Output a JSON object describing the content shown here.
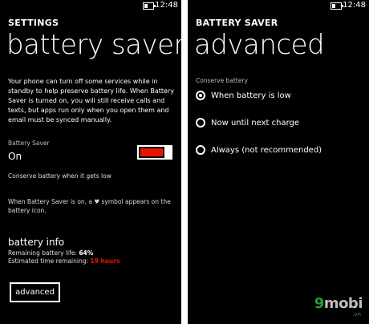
{
  "status": {
    "time": "12:48"
  },
  "left": {
    "section": "SETTINGS",
    "title": "battery saver",
    "description": "Your phone can turn off some services while in standby to help preserve battery life. When Battery Saver is turned on, you will still receive calls and texts, but apps run only when you open them and email must be synced manually.",
    "toggle": {
      "label": "Battery Saver",
      "state": "On",
      "on": true,
      "accent": "#e51400"
    },
    "conserve_note": "Conserve battery when it gets low",
    "symbol_note": "When Battery Saver is on, a ♥ symbol appears on the battery icon.",
    "info": {
      "heading": "battery info",
      "remaining_label": "Remaining battery life:",
      "remaining_value": "64%",
      "estimated_label": "Estimated time remaining:",
      "estimated_value": "19 hours"
    },
    "advanced_button": "advanced"
  },
  "right": {
    "section": "BATTERY SAVER",
    "title": "advanced",
    "group_label": "Conserve battery",
    "options": [
      {
        "label": "When battery is low",
        "selected": true
      },
      {
        "label": "Now until next charge",
        "selected": false
      },
      {
        "label": "Always (not recommended)",
        "selected": false
      }
    ]
  },
  "watermark": {
    "digit": "9",
    "text": "mobi",
    "sub": ".vn"
  }
}
